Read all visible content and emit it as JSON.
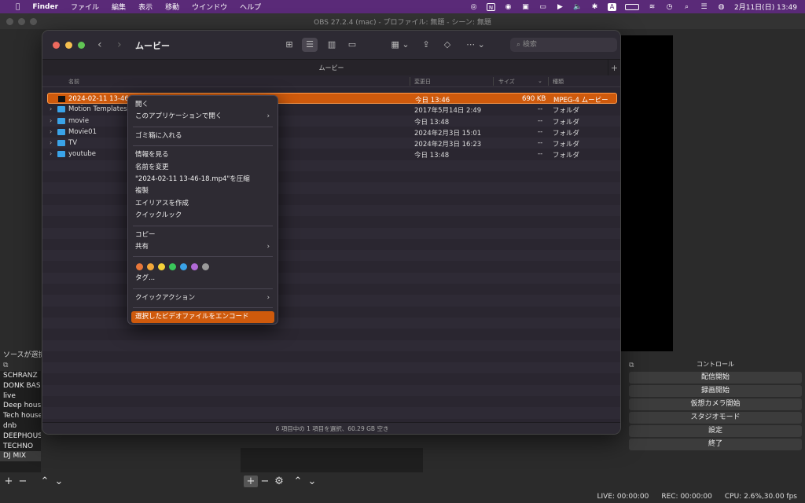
{
  "menubar": {
    "items": [
      "Finder",
      "ファイル",
      "編集",
      "表示",
      "移動",
      "ウインドウ",
      "ヘルプ"
    ],
    "clock": "2月11日(日)  13:49",
    "input_letter": "A"
  },
  "obs": {
    "title": "OBS 27.2.4 (mac) - プロファイル: 無題 - シーン: 無題",
    "sources_title": "ソースが選択",
    "sources": [
      "SCHRANZ",
      "DONK BASS",
      "live",
      "Deep house",
      "Tech house",
      "dnb",
      "DEEPHOUSE",
      "TECHNO",
      "DJ MIX"
    ],
    "controls_title": "コントロール",
    "controls": [
      "配信開始",
      "録画開始",
      "仮想カメラ開始",
      "スタジオモード",
      "設定",
      "終了"
    ],
    "status": {
      "live": "LIVE: 00:00:00",
      "rec": "REC: 00:00:00",
      "cpu": "CPU: 2.6%,30.00 fps"
    }
  },
  "finder": {
    "title": "ムービー",
    "tab_label": "ムービー",
    "search_placeholder": "検索",
    "columns": {
      "name": "名前",
      "date": "変更日",
      "size": "サイズ",
      "kind": "種類"
    },
    "files": [
      {
        "name": "2024-02-11 13-46",
        "date": "今日 13:46",
        "size": "690 KB",
        "kind": "MPEG-4 ムービー",
        "type": "file"
      },
      {
        "name": "Motion Templates",
        "date": "2017年5月14日 2:49",
        "size": "--",
        "kind": "フォルダ",
        "type": "folder"
      },
      {
        "name": "movie",
        "date": "今日 13:48",
        "size": "--",
        "kind": "フォルダ",
        "type": "folder"
      },
      {
        "name": "Movie01",
        "date": "2024年2月3日 15:01",
        "size": "--",
        "kind": "フォルダ",
        "type": "folder"
      },
      {
        "name": "TV",
        "date": "2024年2月3日 16:23",
        "size": "--",
        "kind": "フォルダ",
        "type": "folder"
      },
      {
        "name": "youtube",
        "date": "今日 13:48",
        "size": "--",
        "kind": "フォルダ",
        "type": "folder"
      }
    ],
    "status": "6 項目中の 1 項目を選択、60.29 GB 空き"
  },
  "context_menu": {
    "group1": [
      {
        "label": "開く"
      },
      {
        "label": "このアプリケーションで開く",
        "sub": true
      }
    ],
    "group2": [
      {
        "label": "ゴミ箱に入れる"
      }
    ],
    "group3": [
      {
        "label": "情報を見る"
      },
      {
        "label": "名前を変更"
      },
      {
        "label": "\"2024-02-11 13-46-18.mp4\"を圧縮"
      },
      {
        "label": "複製"
      },
      {
        "label": "エイリアスを作成"
      },
      {
        "label": "クイックルック"
      }
    ],
    "group4": [
      {
        "label": "コピー"
      },
      {
        "label": "共有",
        "sub": true
      }
    ],
    "tag_colors": [
      "#e8773a",
      "#f2a83a",
      "#f5d23a",
      "#3ac75a",
      "#3aa3e8",
      "#b06ad6",
      "#9a9a9a"
    ],
    "tags_label": "タグ...",
    "quick_action": "クイックアクション",
    "encode": "選択したビデオファイルをエンコード"
  }
}
